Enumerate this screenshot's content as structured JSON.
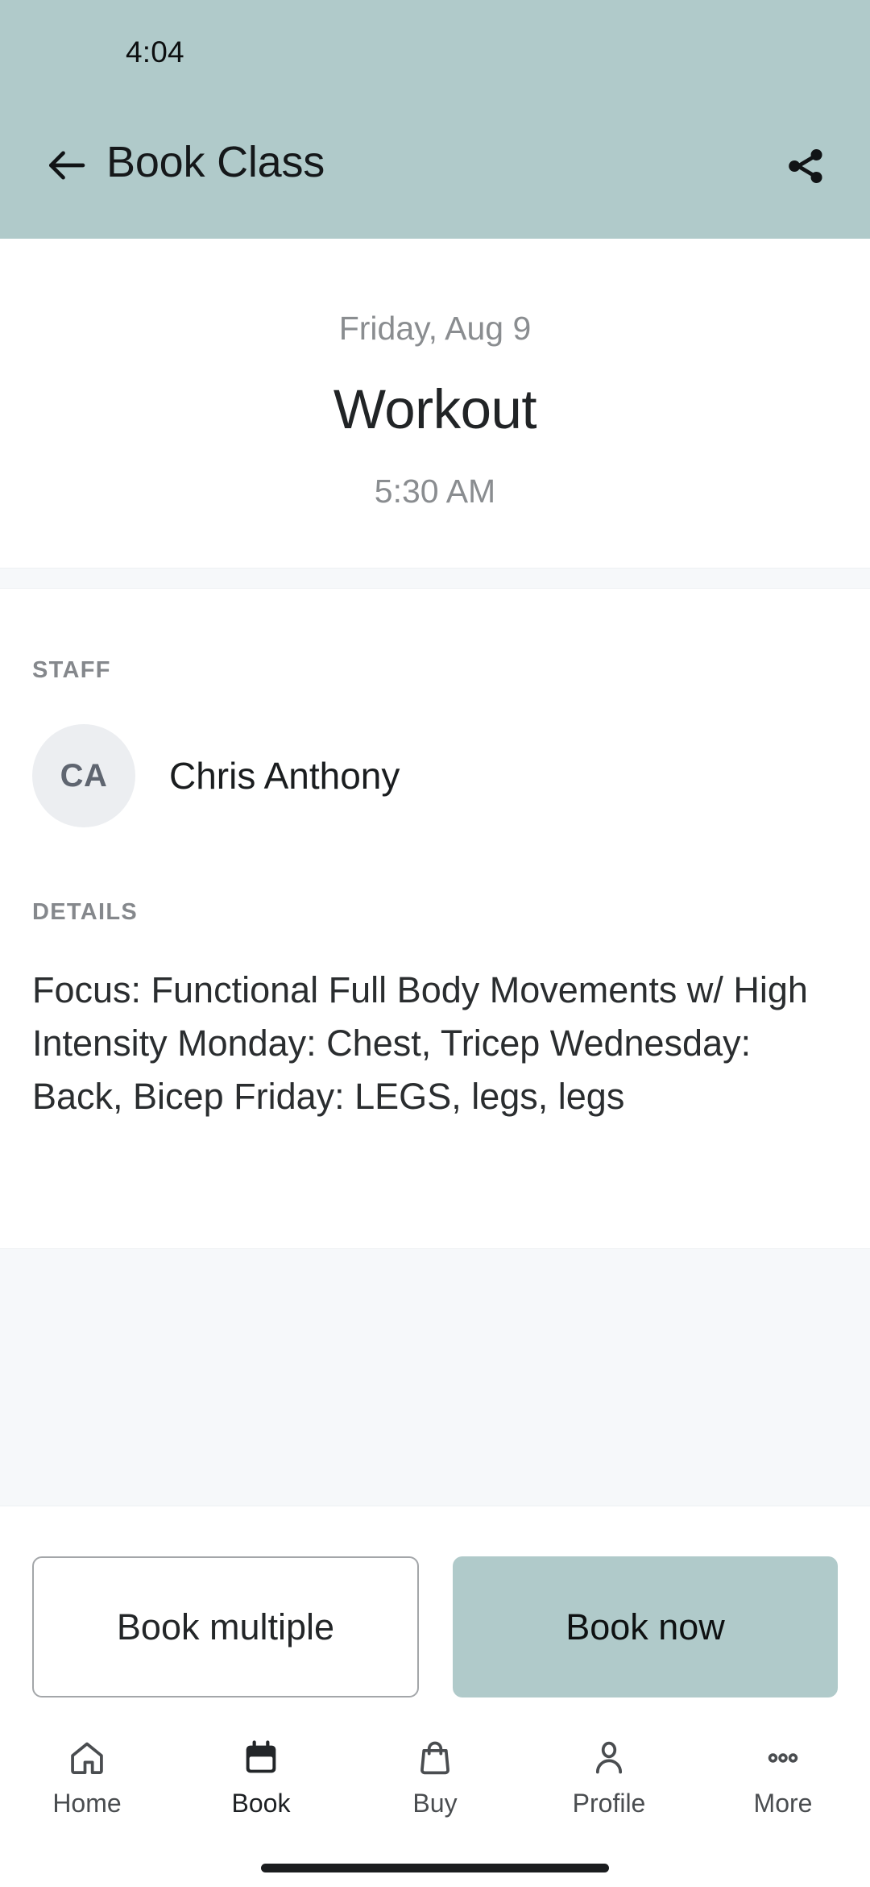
{
  "status_bar": {
    "time": "4:04"
  },
  "app_bar": {
    "title": "Book Class",
    "back_icon": "arrow-left-icon",
    "share_icon": "share-icon",
    "background_color": "#b0caca"
  },
  "hero": {
    "date": "Friday, Aug 9",
    "class_name": "Workout",
    "time": "5:30 AM"
  },
  "staff": {
    "section_label": "STAFF",
    "avatar_initials": "CA",
    "name": "Chris Anthony"
  },
  "details": {
    "section_label": "DETAILS",
    "text": "Focus: Functional Full Body Movements w/ High Intensity Monday: Chest, Tricep Wednesday: Back, Bicep Friday: LEGS, legs, legs"
  },
  "actions": {
    "secondary_label": "Book multiple",
    "primary_label": "Book now",
    "primary_color": "#b0caca"
  },
  "bottom_nav": {
    "items": [
      {
        "label": "Home",
        "icon": "home-icon",
        "active": false
      },
      {
        "label": "Book",
        "icon": "calendar-icon",
        "active": true
      },
      {
        "label": "Buy",
        "icon": "shopping-bag-icon",
        "active": false
      },
      {
        "label": "Profile",
        "icon": "person-icon",
        "active": false
      },
      {
        "label": "More",
        "icon": "ellipsis-icon",
        "active": false
      }
    ]
  }
}
